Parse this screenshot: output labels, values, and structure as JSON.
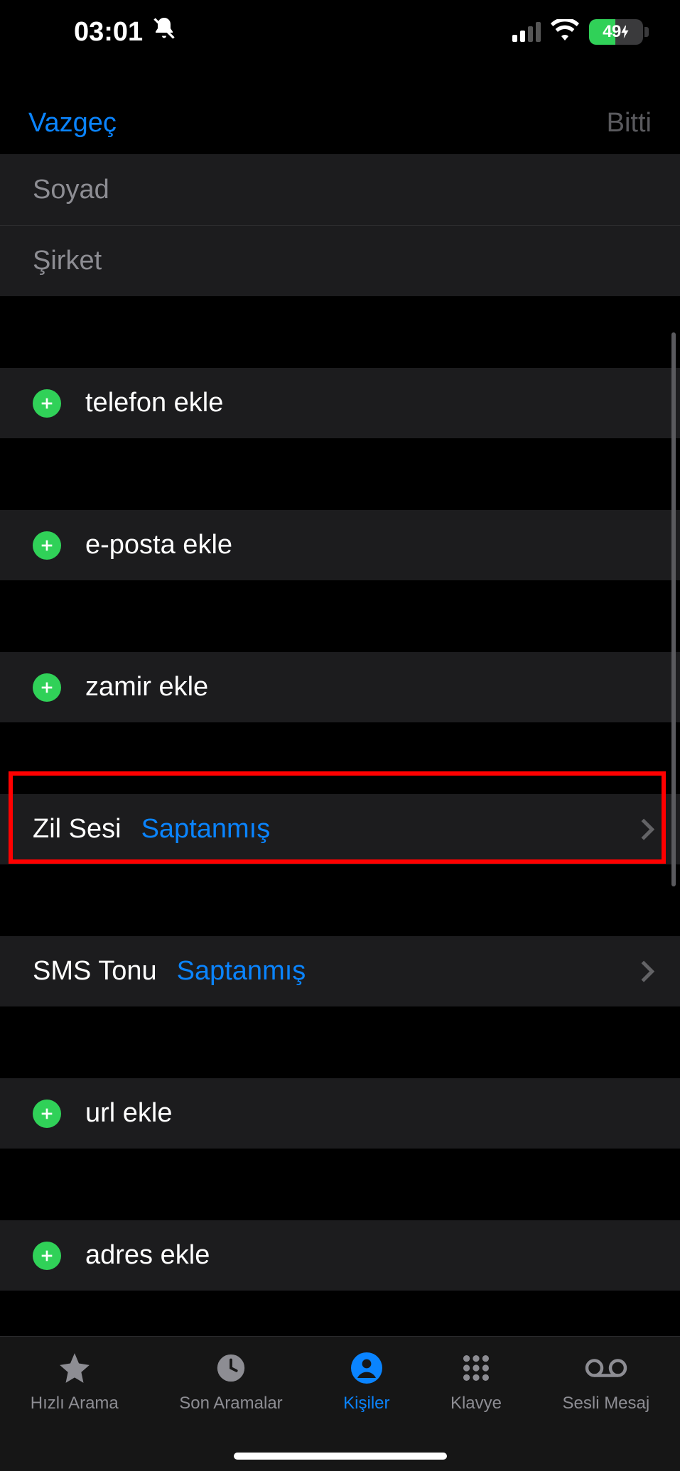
{
  "status": {
    "time": "03:01",
    "battery_pct": "49"
  },
  "nav": {
    "cancel": "Vazgeç",
    "done": "Bitti"
  },
  "fields": {
    "lastname_placeholder": "Soyad",
    "company_placeholder": "Şirket"
  },
  "add": {
    "phone": "telefon ekle",
    "email": "e-posta ekle",
    "pronoun": "zamir ekle",
    "url": "url ekle",
    "address": "adres ekle"
  },
  "ringtone": {
    "label": "Zil Sesi",
    "value": "Saptanmış"
  },
  "texttone": {
    "label": "SMS Tonu",
    "value": "Saptanmış"
  },
  "tabs": {
    "favorites": "Hızlı Arama",
    "recents": "Son Aramalar",
    "contacts": "Kişiler",
    "keypad": "Klavye",
    "voicemail": "Sesli Mesaj"
  }
}
